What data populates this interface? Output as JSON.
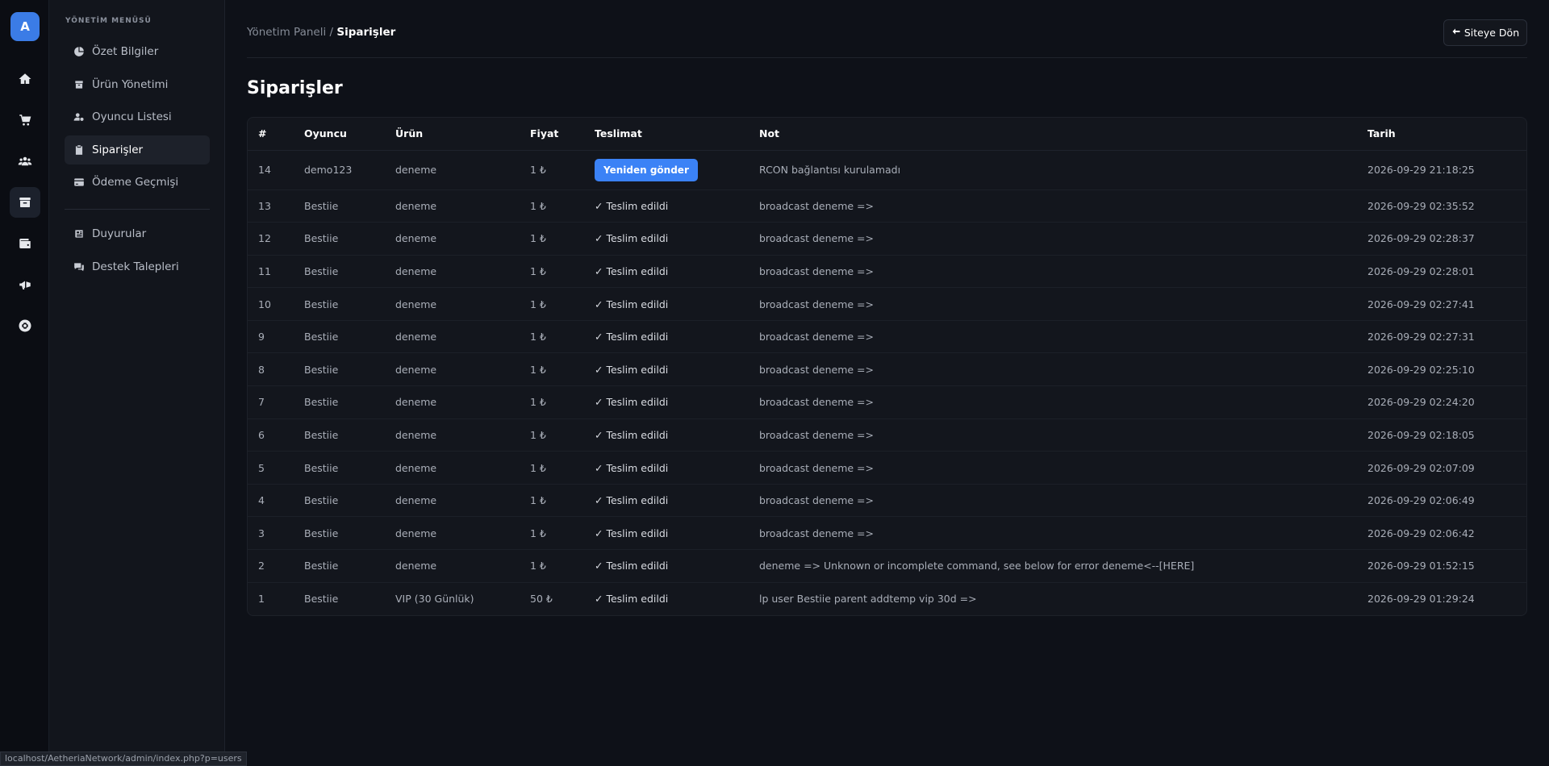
{
  "rail": {
    "avatar_letter": "A",
    "icons": [
      "home-icon",
      "cart-icon",
      "users-icon",
      "archive-icon",
      "wallet-icon",
      "megaphone-icon",
      "support-icon"
    ]
  },
  "menu": {
    "title": "YÖNETİM MENÜSÜ",
    "items": [
      {
        "label": "Özet Bilgiler",
        "icon": "chart-pie-icon"
      },
      {
        "label": "Ürün Yönetimi",
        "icon": "box-icon"
      },
      {
        "label": "Oyuncu Listesi",
        "icon": "user-gear-icon"
      },
      {
        "label": "Siparişler",
        "icon": "clipboard-icon"
      },
      {
        "label": "Ödeme Geçmişi",
        "icon": "credit-card-icon"
      },
      {
        "label": "Duyurular",
        "icon": "newspaper-icon"
      },
      {
        "label": "Destek Talepleri",
        "icon": "comments-icon"
      }
    ]
  },
  "header": {
    "breadcrumb_parent": "Yönetim Paneli",
    "breadcrumb_sep": "/",
    "breadcrumb_current": "Siparişler",
    "back_label": "Siteye Dön"
  },
  "page": {
    "title": "Siparişler"
  },
  "table": {
    "columns": [
      "#",
      "Oyuncu",
      "Ürün",
      "Fiyat",
      "Teslimat",
      "Not",
      "Tarih"
    ],
    "rows": [
      {
        "id": "14",
        "player": "demo123",
        "product": "deneme",
        "price": "1 ₺",
        "delivery": "Yeniden gönder",
        "note": "RCON bağlantısı kurulamadı",
        "date": "2026-09-29 21:18:25"
      },
      {
        "id": "13",
        "player": "Bestiie",
        "product": "deneme",
        "price": "1 ₺",
        "delivery": "✓ Teslim edildi",
        "note": "broadcast deneme =>",
        "date": "2026-09-29 02:35:52"
      },
      {
        "id": "12",
        "player": "Bestiie",
        "product": "deneme",
        "price": "1 ₺",
        "delivery": "✓ Teslim edildi",
        "note": "broadcast deneme =>",
        "date": "2026-09-29 02:28:37"
      },
      {
        "id": "11",
        "player": "Bestiie",
        "product": "deneme",
        "price": "1 ₺",
        "delivery": "✓ Teslim edildi",
        "note": "broadcast deneme =>",
        "date": "2026-09-29 02:28:01"
      },
      {
        "id": "10",
        "player": "Bestiie",
        "product": "deneme",
        "price": "1 ₺",
        "delivery": "✓ Teslim edildi",
        "note": "broadcast deneme =>",
        "date": "2026-09-29 02:27:41"
      },
      {
        "id": "9",
        "player": "Bestiie",
        "product": "deneme",
        "price": "1 ₺",
        "delivery": "✓ Teslim edildi",
        "note": "broadcast deneme =>",
        "date": "2026-09-29 02:27:31"
      },
      {
        "id": "8",
        "player": "Bestiie",
        "product": "deneme",
        "price": "1 ₺",
        "delivery": "✓ Teslim edildi",
        "note": "broadcast deneme =>",
        "date": "2026-09-29 02:25:10"
      },
      {
        "id": "7",
        "player": "Bestiie",
        "product": "deneme",
        "price": "1 ₺",
        "delivery": "✓ Teslim edildi",
        "note": "broadcast deneme =>",
        "date": "2026-09-29 02:24:20"
      },
      {
        "id": "6",
        "player": "Bestiie",
        "product": "deneme",
        "price": "1 ₺",
        "delivery": "✓ Teslim edildi",
        "note": "broadcast deneme =>",
        "date": "2026-09-29 02:18:05"
      },
      {
        "id": "5",
        "player": "Bestiie",
        "product": "deneme",
        "price": "1 ₺",
        "delivery": "✓ Teslim edildi",
        "note": "broadcast deneme =>",
        "date": "2026-09-29 02:07:09"
      },
      {
        "id": "4",
        "player": "Bestiie",
        "product": "deneme",
        "price": "1 ₺",
        "delivery": "✓ Teslim edildi",
        "note": "broadcast deneme =>",
        "date": "2026-09-29 02:06:49"
      },
      {
        "id": "3",
        "player": "Bestiie",
        "product": "deneme",
        "price": "1 ₺",
        "delivery": "✓ Teslim edildi",
        "note": "broadcast deneme =>",
        "date": "2026-09-29 02:06:42"
      },
      {
        "id": "2",
        "player": "Bestiie",
        "product": "deneme",
        "price": "1 ₺",
        "delivery": "✓ Teslim edildi",
        "note": "deneme => Unknown or incomplete command, see below for error deneme<--[HERE]",
        "date": "2026-09-29 01:52:15"
      },
      {
        "id": "1",
        "player": "Bestiie",
        "product": "VIP (30 Günlük)",
        "price": "50 ₺",
        "delivery": "✓ Teslim edildi",
        "note": "lp user Bestiie parent addtemp vip 30d =>",
        "date": "2026-09-29 01:29:24"
      }
    ]
  },
  "statusbar": {
    "url": "localhost/AetheriaNetwork/admin/index.php?p=users"
  },
  "colors": {
    "accent": "#3b82f6",
    "background": "#0e1118",
    "panel": "#12151c"
  }
}
